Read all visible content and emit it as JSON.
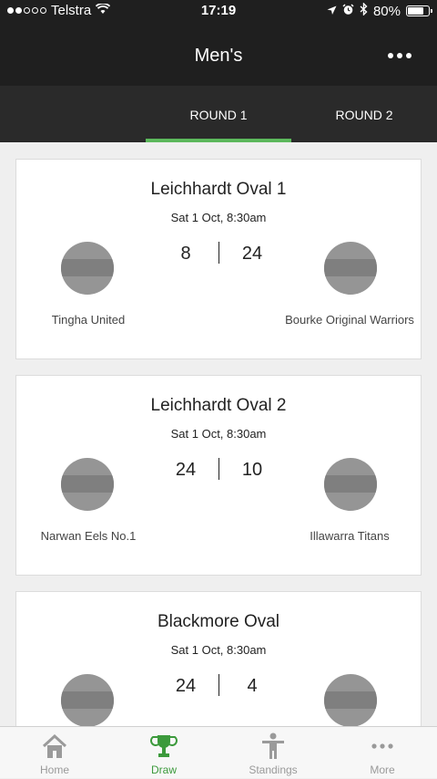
{
  "status_bar": {
    "carrier": "Telstra",
    "time": "17:19",
    "battery": "80%",
    "battery_level": 0.8
  },
  "header": {
    "title": "Men's"
  },
  "tabs": [
    {
      "label": "ROUND 1",
      "active": true
    },
    {
      "label": "ROUND 2",
      "active": false
    }
  ],
  "matches": [
    {
      "venue": "Leichhardt Oval 1",
      "date": "Sat 1 Oct, 8:30am",
      "home_team": "Tingha United",
      "home_score": "8",
      "away_team": "Bourke Original Warriors",
      "away_score": "24"
    },
    {
      "venue": "Leichhardt Oval 2",
      "date": "Sat 1 Oct, 8:30am",
      "home_team": "Narwan Eels No.1",
      "home_score": "24",
      "away_team": "Illawarra Titans",
      "away_score": "10"
    },
    {
      "venue": "Blackmore Oval",
      "date": "Sat 1 Oct, 8:30am",
      "home_team": "",
      "home_score": "24",
      "away_team": "",
      "away_score": "4"
    }
  ],
  "bottom_nav": [
    {
      "label": "Home",
      "icon": "home-icon",
      "active": false
    },
    {
      "label": "Draw",
      "icon": "trophy-icon",
      "active": true
    },
    {
      "label": "Standings",
      "icon": "person-icon",
      "active": false
    },
    {
      "label": "More",
      "icon": "more-icon",
      "active": false
    }
  ],
  "colors": {
    "accent": "#5cb85c",
    "header_bg": "#1f1f1f",
    "tab_bg": "#2a2a2a",
    "logo_placeholder": "#959595"
  }
}
